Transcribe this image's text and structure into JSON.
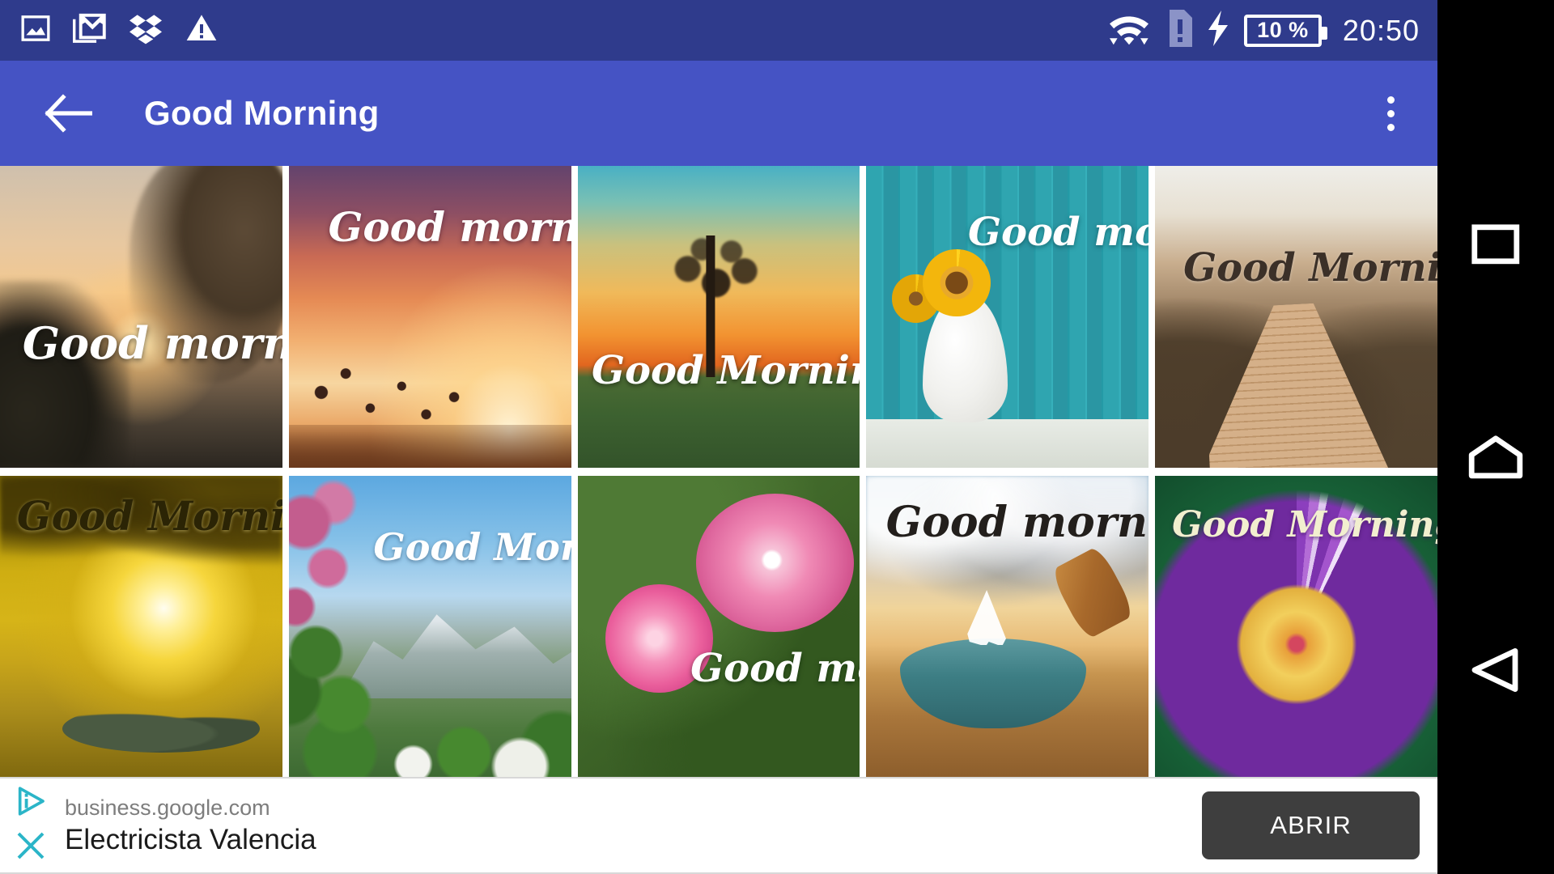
{
  "status_bar": {
    "icons": [
      "photos-icon",
      "gmail-icon",
      "dropbox-icon",
      "warning-triangle-icon",
      "wifi-icon",
      "sim-card-warning-icon",
      "charging-bolt-icon"
    ],
    "battery_level": "10 %",
    "time": "20:50",
    "background_color": "#2f3b8c"
  },
  "app_bar": {
    "back_icon": "arrow-left-icon",
    "title": "Good Morning",
    "overflow_icon": "more-vertical-icon",
    "background_color": "#4553c4"
  },
  "gallery": {
    "columns": 5,
    "rows": 2,
    "items": [
      {
        "id": 1,
        "caption": "Good morning",
        "scene": "sunrise over lake with trees and bench",
        "art_class": "art1",
        "text_color": "#ffffff",
        "text_top": "52%",
        "text_left": "8%",
        "text_size": "54px"
      },
      {
        "id": 2,
        "caption": "Good morning",
        "scene": "thistle silhouettes against purple orange sunset",
        "art_class": "art2",
        "text_color": "#ffffff",
        "text_top": "14%",
        "text_left": "16%",
        "text_size": "50px"
      },
      {
        "id": 3,
        "caption": "Good Morning",
        "scene": "lone bare tree on green field at sunset",
        "art_class": "art3",
        "text_color": "#ffffff",
        "text_top": "62%",
        "text_left": "6%",
        "text_size": "48px"
      },
      {
        "id": 4,
        "caption": "Good morning",
        "scene": "sunflowers in white vase on teal wooden planks",
        "art_class": "art4",
        "text_color": "#ffffff",
        "text_top": "16%",
        "text_left": "40%",
        "text_size": "48px"
      },
      {
        "id": 5,
        "caption": "Good Morning",
        "scene": "wooden boardwalk through misty autumn woods",
        "art_class": "art5",
        "text_color": "#3b3028",
        "text_top": "28%",
        "text_left": "12%",
        "text_size": "48px"
      },
      {
        "id": 6,
        "caption": "Good Morning!",
        "scene": "golden sunrise fisherman casting net from boat",
        "art_class": "art6",
        "text_color": "#2b2405",
        "text_top": "8%",
        "text_left": "8%",
        "text_size": "50px"
      },
      {
        "id": 7,
        "caption": "Good Morning",
        "scene": "lilac blossoms with snowy mountain and blue sky",
        "art_class": "art7",
        "text_color": "#ffffff",
        "text_top": "18%",
        "text_left": "32%",
        "text_size": "46px"
      },
      {
        "id": 8,
        "caption": "Good morning",
        "scene": "pink roses on branch with green bokeh",
        "art_class": "art8",
        "text_color": "#ffffff",
        "text_top": "58%",
        "text_left": "44%",
        "text_size": "48px"
      },
      {
        "id": 9,
        "caption": "Good morning",
        "scene": "sailing ship inside water bottle on desert sand",
        "art_class": "art9",
        "text_color": "#231f1c",
        "text_top": "10%",
        "text_left": "8%",
        "text_size": "52px"
      },
      {
        "id": 10,
        "caption": "Good Morning",
        "scene": "purple water lily with yellow center",
        "art_class": "art10",
        "text_color": "#f2efcf",
        "text_top": "12%",
        "text_left": "8%",
        "text_size": "44px"
      }
    ]
  },
  "ad_banner": {
    "adchoices_icon": "adchoices-triangle-icon",
    "close_icon": "close-x-icon",
    "url": "business.google.com",
    "title": "Electricista Valencia",
    "cta_label": "ABRIR",
    "cta_color": "#3e3e3e",
    "accent_color": "#2bb5c8"
  },
  "nav_bar": {
    "recents_icon": "square-recents-icon",
    "home_icon": "home-pentagon-icon",
    "back_icon": "triangle-back-icon",
    "background_color": "#000000"
  }
}
